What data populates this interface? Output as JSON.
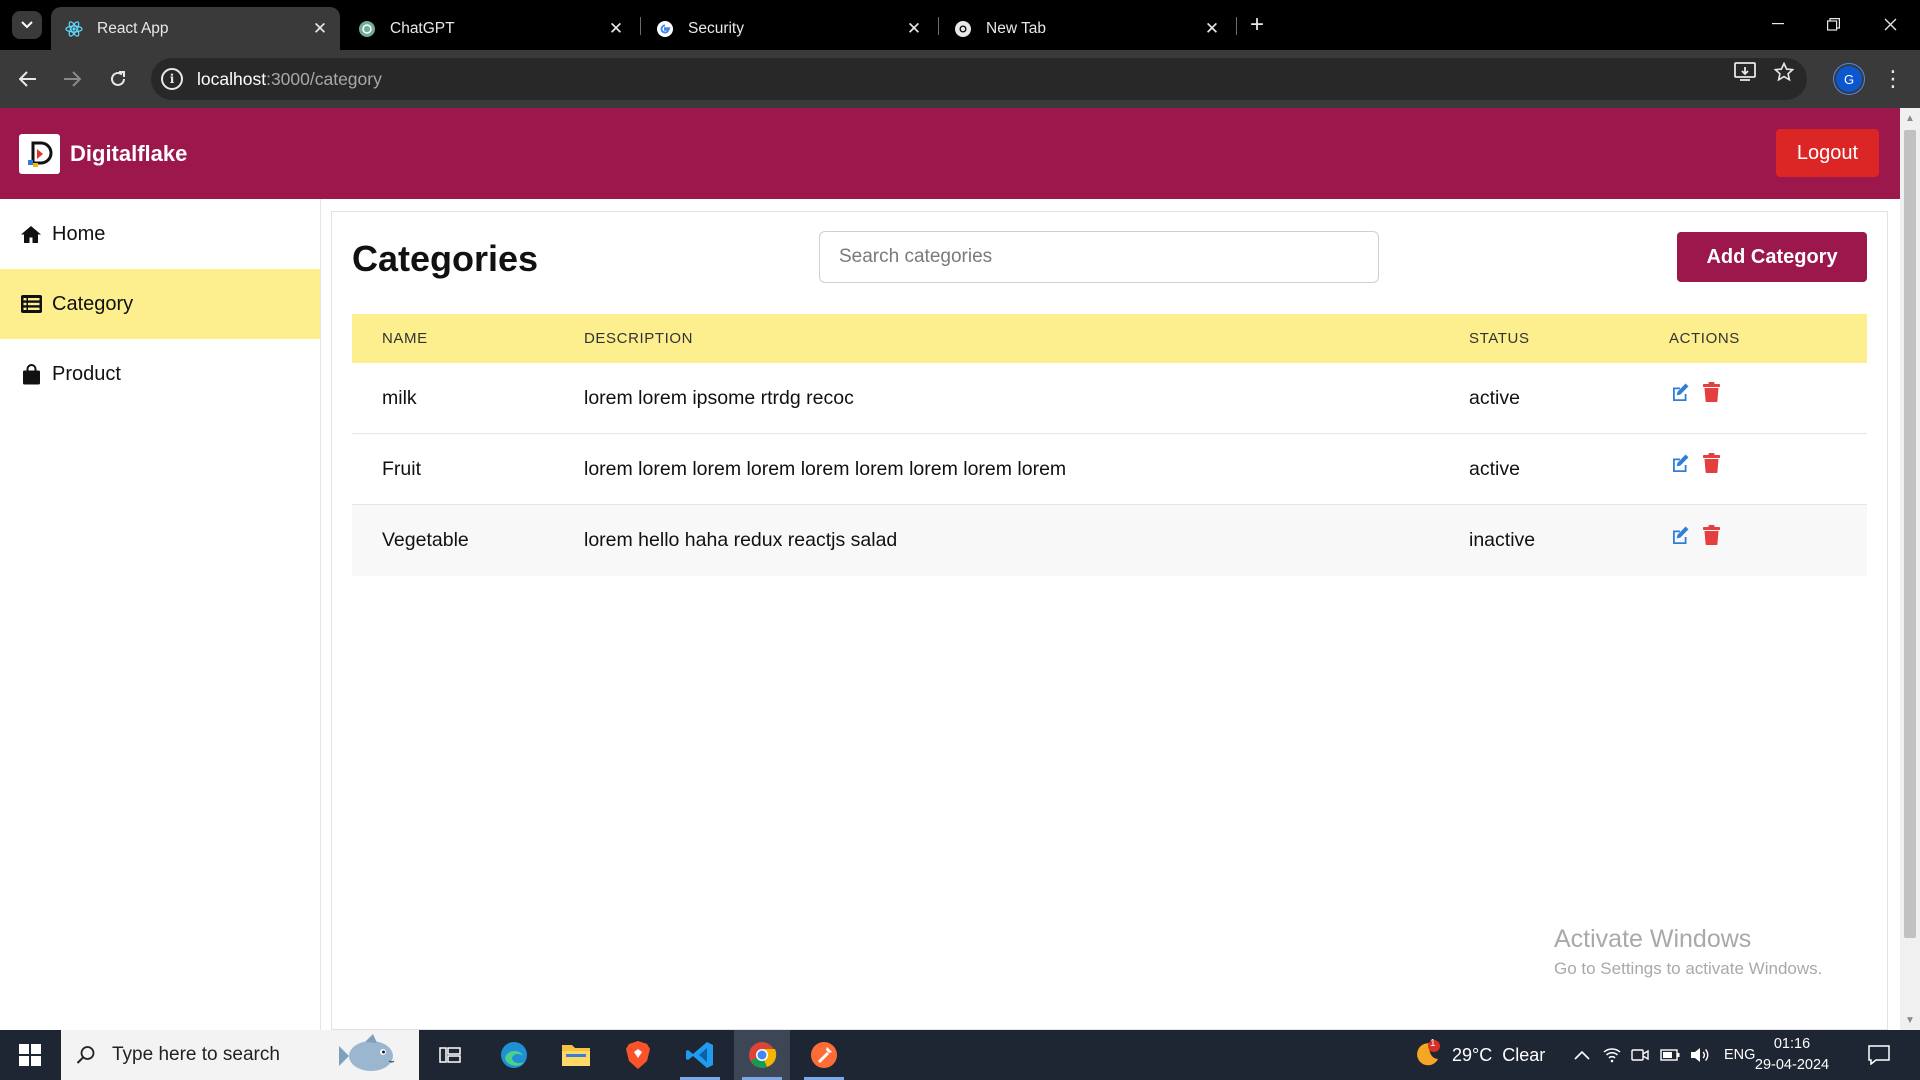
{
  "browser": {
    "tabs": [
      {
        "title": "React App",
        "icon": "react-icon",
        "active": true
      },
      {
        "title": "ChatGPT",
        "icon": "chatgpt-icon",
        "active": false
      },
      {
        "title": "Security",
        "icon": "google-icon",
        "active": false
      },
      {
        "title": "New Tab",
        "icon": "chrome-icon",
        "active": false
      }
    ],
    "url": {
      "host": "localhost",
      "rest": ":3000/category"
    },
    "profile_initial": "G"
  },
  "app": {
    "brand": "Digitalflake",
    "logout_label": "Logout",
    "sidebar": [
      {
        "label": "Home",
        "icon": "home-icon",
        "active": false
      },
      {
        "label": "Category",
        "icon": "list-icon",
        "active": true
      },
      {
        "label": "Product",
        "icon": "shopping-bag-icon",
        "active": false
      }
    ],
    "page_title": "Categories",
    "search_placeholder": "Search categories",
    "add_button_label": "Add Category",
    "table": {
      "headers": {
        "name": "NAME",
        "description": "DESCRIPTION",
        "status": "STATUS",
        "actions": "ACTIONS"
      },
      "rows": [
        {
          "name": "milk",
          "description": "lorem lorem ipsome rtrdg recoc",
          "status": "active"
        },
        {
          "name": "Fruit",
          "description": "lorem lorem lorem lorem lorem lorem lorem lorem lorem",
          "status": "active"
        },
        {
          "name": "Vegetable",
          "description": "lorem hello haha redux reactjs salad",
          "status": "inactive"
        }
      ]
    },
    "colors": {
      "primary": "#9b174c",
      "highlight": "#fdef8e",
      "danger": "#dc2626",
      "edit": "#2f7fd6"
    }
  },
  "watermark": {
    "title": "Activate Windows",
    "subtitle": "Go to Settings to activate Windows."
  },
  "taskbar": {
    "search_placeholder": "Type here to search",
    "apps": [
      "task-view-icon",
      "edge-icon",
      "file-explorer-icon",
      "brave-icon",
      "vscode-icon",
      "chrome-icon",
      "postman-icon"
    ],
    "weather": {
      "temp": "29°C",
      "condition": "Clear",
      "badge": "1"
    },
    "language": "ENG",
    "time": "01:16",
    "date": "29-04-2024"
  }
}
